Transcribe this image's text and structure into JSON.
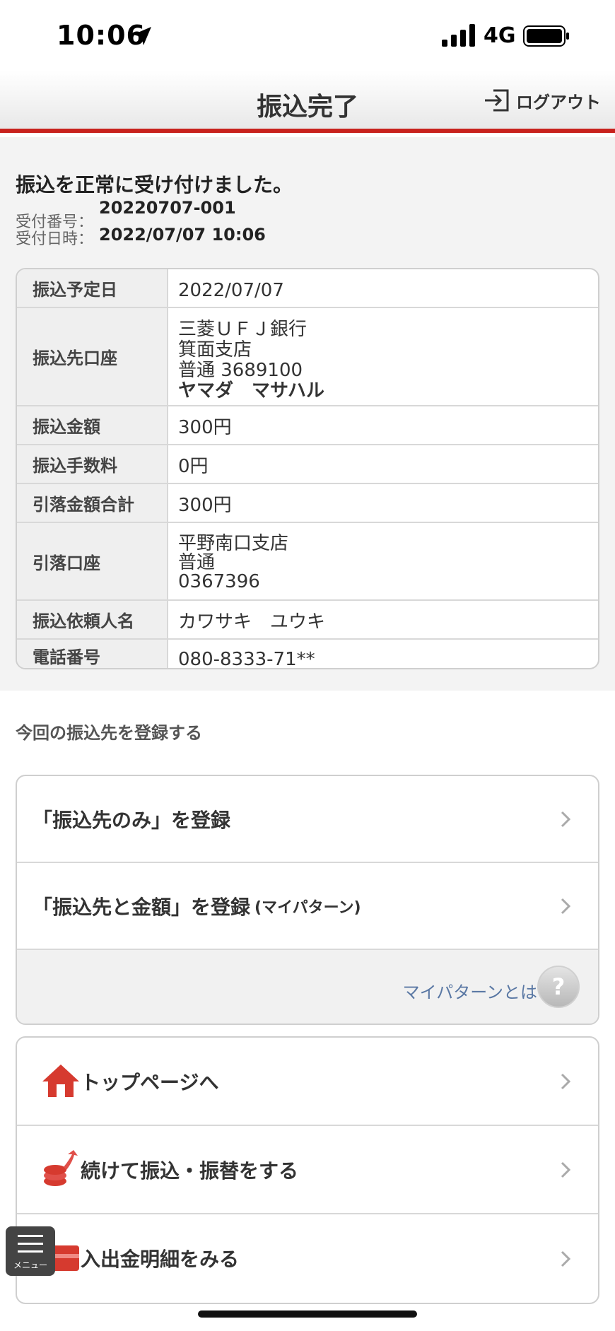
{
  "status_bar": {
    "time": "10:06",
    "network": "4G"
  },
  "header": {
    "title": "振込完了",
    "logout_label": "ログアウト"
  },
  "complete": {
    "message": "振込を正常に受け付けました。",
    "receipt_number_label": "受付番号：",
    "receipt_number": "20220707-001",
    "receipt_datetime_label": "受付日時：",
    "receipt_datetime": "2022/07/07 10:06"
  },
  "details": {
    "scheduled_date_label": "振込予定日",
    "scheduled_date": "2022/07/07",
    "dest_account_label": "振込先口座",
    "dest_bank": "三菱ＵＦＪ銀行",
    "dest_branch": "箕面支店",
    "dest_type_number": "普通 3689100",
    "dest_name": "ヤマダ　マサハル",
    "amount_label": "振込金額",
    "amount": "300円",
    "fee_label": "振込手数料",
    "fee": "0円",
    "total_label": "引落金額合計",
    "total": "300円",
    "debit_account_label": "引落口座",
    "debit_branch": "平野南口支店",
    "debit_type": "普通",
    "debit_number": "0367396",
    "requester_label": "振込依頼人名",
    "requester": "カワサキ　ユウキ",
    "phone_label": "電話番号",
    "phone": "080-8333-71**"
  },
  "register": {
    "heading": "今回の振込先を登録する",
    "register_dest_only": "「振込先のみ」を登録",
    "register_dest_amount": "「振込先と金額」を登録",
    "register_dest_amount_sub": "(マイパターン)",
    "mypattern_link": "マイパターンとは",
    "help_glyph": "?"
  },
  "nav": {
    "top_page": "トップページへ",
    "continue_transfer": "続けて振込・振替をする",
    "statement": "入出金明細をみる"
  },
  "menu": {
    "label": "メニュー"
  },
  "colors": {
    "accent_red": "#c8221d",
    "link_blue": "#5a78a4"
  }
}
